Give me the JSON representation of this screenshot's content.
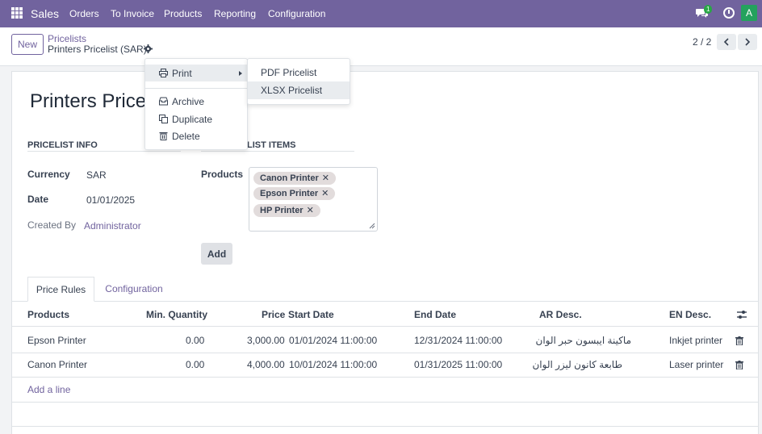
{
  "navbar": {
    "brand": "Sales",
    "menu": [
      "Orders",
      "To Invoice",
      "Products",
      "Reporting",
      "Configuration"
    ],
    "chat_badge": "1",
    "avatar_letter": "A"
  },
  "control": {
    "new_label": "New",
    "breadcrumb_parent": "Pricelists",
    "breadcrumb_current": "Printers Pricelist (SAR)",
    "pager": "2 / 2"
  },
  "form": {
    "title": "Printers Pricel",
    "section_info": "Pricelist Info",
    "section_items": "list Items",
    "currency_label": "Currency",
    "currency_value": "SAR",
    "date_label": "Date",
    "date_value": "01/01/2025",
    "created_by_label": "Created By",
    "created_by_value": "Administrator",
    "products_label": "Products",
    "tags": [
      "Canon Printer",
      "Epson Printer",
      "HP Printer"
    ],
    "add_label": "Add"
  },
  "tabs": [
    "Price Rules",
    "Configuration"
  ],
  "table": {
    "headers": [
      "Products",
      "Min. Quantity",
      "Price",
      "Start Date",
      "End Date",
      "AR Desc.",
      "EN Desc."
    ],
    "rows": [
      [
        "Epson Printer",
        "0.00",
        "3,000.00",
        "01/01/2024 11:00:00",
        "12/31/2024 11:00:00",
        "ماكينة ايبسون حبر الوان",
        "Inkjet printer"
      ],
      [
        "Canon Printer",
        "0.00",
        "4,000.00",
        "10/01/2024 11:00:00",
        "01/31/2025 11:00:00",
        "طابعة كانون ليزر الوان",
        "Laser printer"
      ]
    ],
    "add_line": "Add a line"
  },
  "dropdown": {
    "items": [
      "Print",
      "Archive",
      "Duplicate",
      "Delete"
    ]
  },
  "print_submenu": {
    "items": [
      "PDF Pricelist",
      "XLSX Pricelist"
    ]
  },
  "colors": {
    "brand": "#71639e",
    "badge": "#28a745",
    "avatar": "#24a25d"
  }
}
